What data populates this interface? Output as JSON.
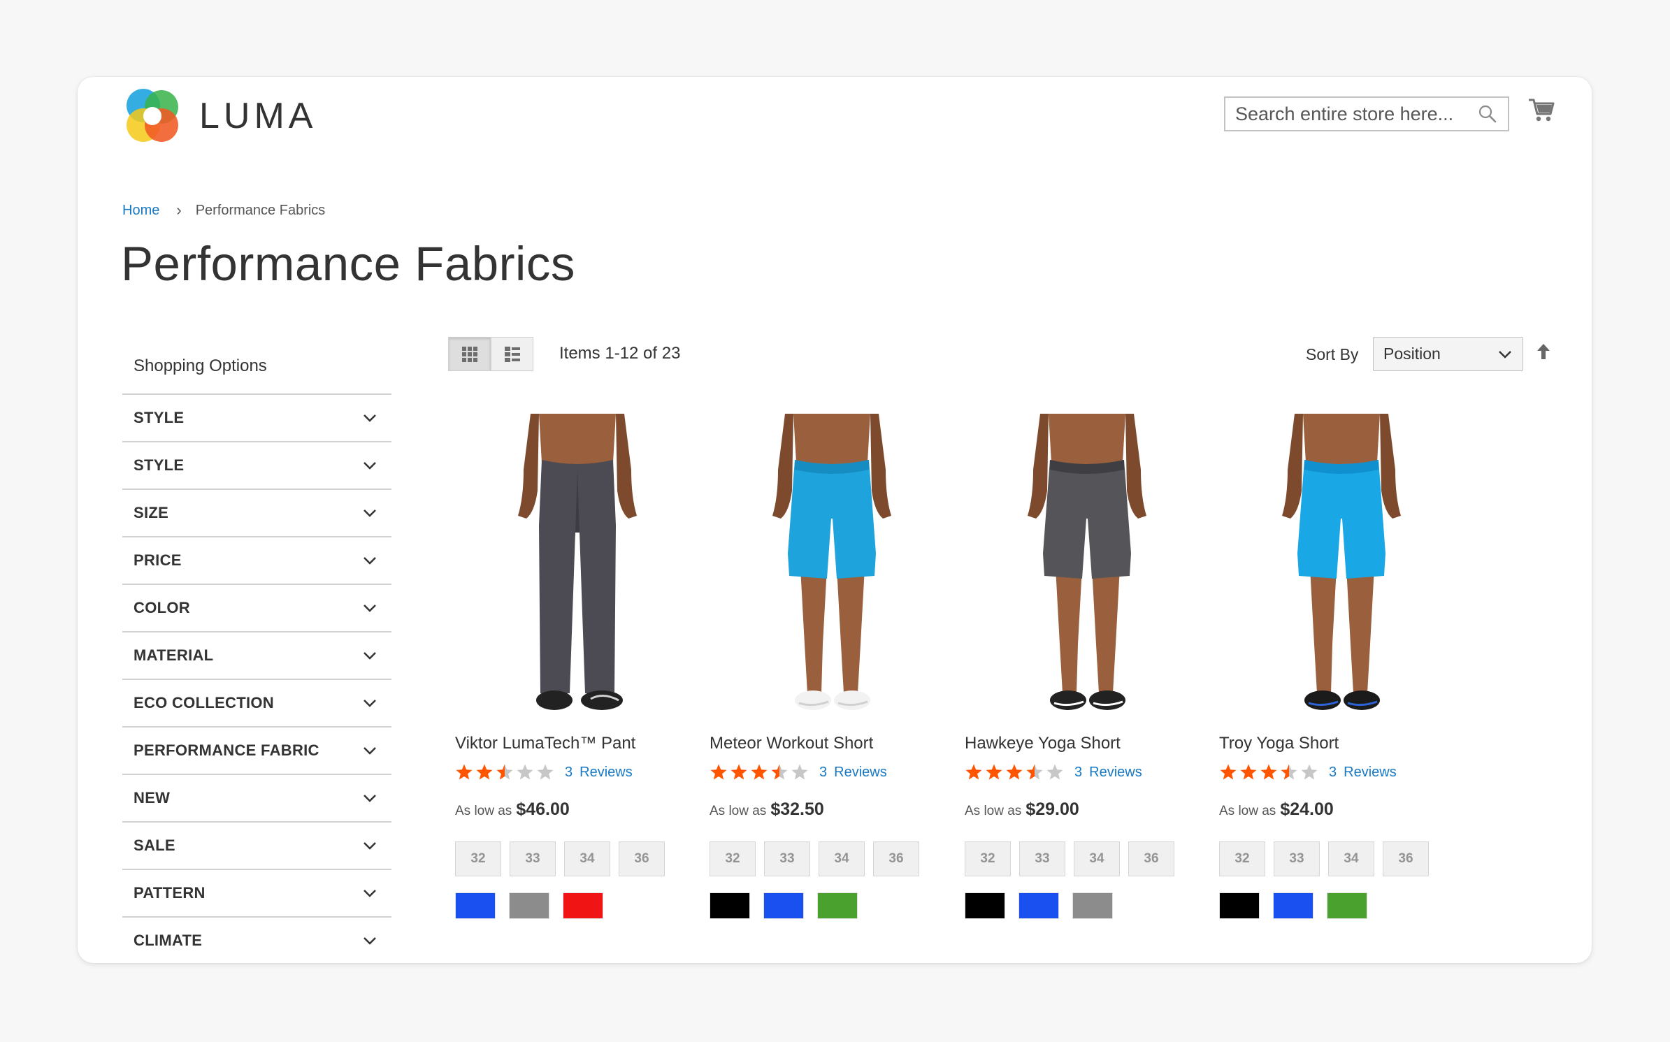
{
  "header": {
    "logo_text": "LUMA",
    "search_placeholder": "Search entire store here...",
    "search_icon": "search-icon",
    "cart_icon": "cart-icon"
  },
  "breadcrumb": {
    "home": "Home",
    "separator": "›",
    "current": "Performance Fabrics"
  },
  "page_title": "Performance Fabrics",
  "sidebar": {
    "title": "Shopping Options",
    "filters": [
      "STYLE",
      "STYLE",
      "SIZE",
      "PRICE",
      "COLOR",
      "MATERIAL",
      "ECO COLLECTION",
      "PERFORMANCE FABRIC",
      "NEW",
      "SALE",
      "PATTERN",
      "CLIMATE"
    ]
  },
  "toolbar": {
    "view_modes": [
      "grid",
      "list"
    ],
    "active_mode": "grid",
    "items_count": "Items 1-12 of 23",
    "sort_label": "Sort By",
    "sort_value": "Position",
    "sort_direction_icon": "arrow-up-icon"
  },
  "products": [
    {
      "name": "Viktor LumaTech™ Pant",
      "rating": 2.5,
      "reviews_count": "3",
      "reviews_label": "Reviews",
      "price_label": "As low as",
      "price": "$46.00",
      "sizes": [
        "32",
        "33",
        "34",
        "36"
      ],
      "colors": [
        "#1a4ff0",
        "#8c8c8c",
        "#f01414"
      ],
      "image": "pants-charcoal"
    },
    {
      "name": "Meteor Workout Short",
      "rating": 3.5,
      "reviews_count": "3",
      "reviews_label": "Reviews",
      "price_label": "As low as",
      "price": "$32.50",
      "sizes": [
        "32",
        "33",
        "34",
        "36"
      ],
      "colors": [
        "#000000",
        "#1a4ff0",
        "#4aa12e"
      ],
      "image": "shorts-blue"
    },
    {
      "name": "Hawkeye Yoga Short",
      "rating": 3.5,
      "reviews_count": "3",
      "reviews_label": "Reviews",
      "price_label": "As low as",
      "price": "$29.00",
      "sizes": [
        "32",
        "33",
        "34",
        "36"
      ],
      "colors": [
        "#000000",
        "#1a4ff0",
        "#8c8c8c"
      ],
      "image": "shorts-gray"
    },
    {
      "name": "Troy Yoga Short",
      "rating": 3.5,
      "reviews_count": "3",
      "reviews_label": "Reviews",
      "price_label": "As low as",
      "price": "$24.00",
      "sizes": [
        "32",
        "33",
        "34",
        "36"
      ],
      "colors": [
        "#000000",
        "#1a4ff0",
        "#4aa12e"
      ],
      "image": "shorts-bright-blue"
    }
  ],
  "colors": {
    "link": "#1979c3",
    "star": "#ff5501",
    "star_empty": "#c7c7c7"
  }
}
